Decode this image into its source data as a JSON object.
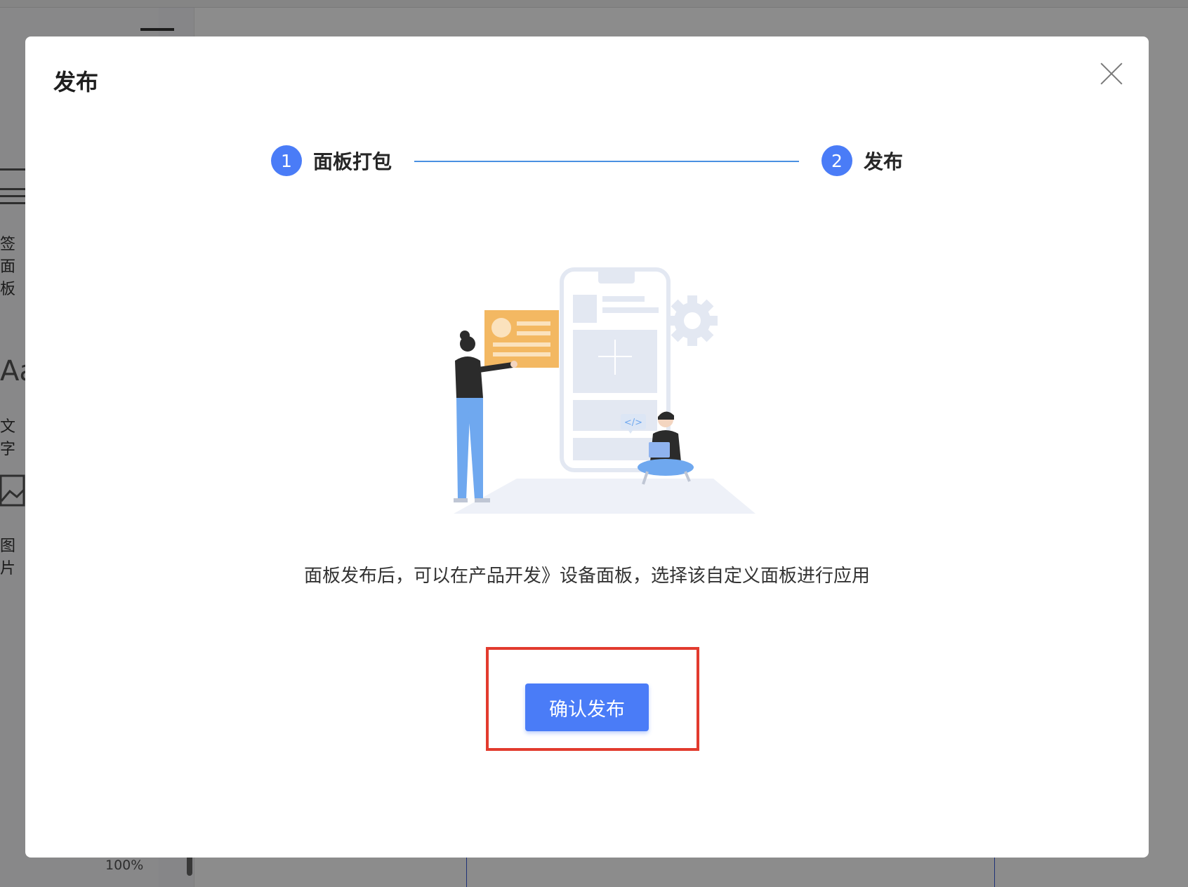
{
  "background": {
    "sidebar_items": [
      "签面板",
      "文字",
      "图片"
    ],
    "aa_glyph": "Aa",
    "zoom_label": "100%"
  },
  "modal": {
    "title": "发布",
    "steps": [
      {
        "number": "1",
        "label": "面板打包"
      },
      {
        "number": "2",
        "label": "发布"
      }
    ],
    "description": "面板发布后，可以在产品开发》设备面板，选择该自定义面板进行应用",
    "confirm_label": "确认发布",
    "code_tag": "</>"
  },
  "colors": {
    "primary": "#4a7cf7",
    "highlight": "#e23b2e",
    "card": "#f3b862"
  }
}
